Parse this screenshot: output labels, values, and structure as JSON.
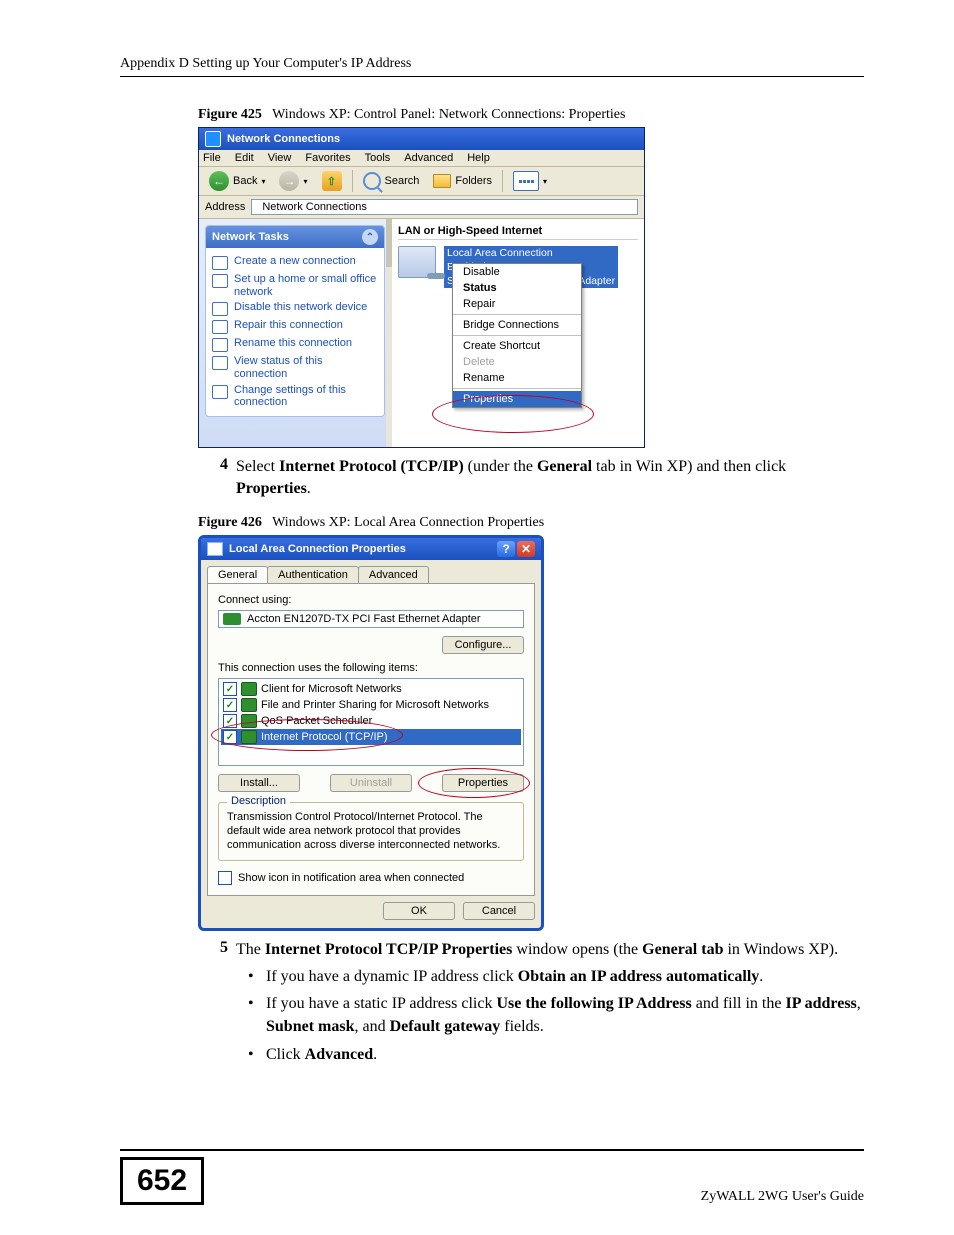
{
  "header": "Appendix D Setting up Your Computer's IP Address",
  "figure425": {
    "label": "Figure 425",
    "caption": "Windows XP: Control Panel: Network Connections: Properties",
    "title": "Network Connections",
    "menu": [
      "File",
      "Edit",
      "View",
      "Favorites",
      "Tools",
      "Advanced",
      "Help"
    ],
    "toolbar": {
      "back": "Back",
      "search": "Search",
      "folders": "Folders"
    },
    "address_label": "Address",
    "address_value": "Network Connections",
    "tasks_header": "Network Tasks",
    "tasks": [
      "Create a new connection",
      "Set up a home or small office network",
      "Disable this network device",
      "Repair this connection",
      "Rename this connection",
      "View status of this connection",
      "Change settings of this connection"
    ],
    "group_header": "LAN or High-Speed Internet",
    "connection": {
      "name": "Local Area Connection",
      "status": "Enabled",
      "device": "Standard PCI Fast Ethernet Adapter"
    },
    "context_menu": {
      "disable": "Disable",
      "status": "Status",
      "repair": "Repair",
      "bridge": "Bridge Connections",
      "shortcut": "Create Shortcut",
      "delete": "Delete",
      "rename": "Rename",
      "properties": "Properties"
    }
  },
  "step4": {
    "num": "4",
    "pre": "Select ",
    "b1": "Internet Protocol (TCP/IP)",
    "mid": " (under the ",
    "b2": "General",
    "post": " tab in Win XP) and then click ",
    "b3": "Properties",
    "end": "."
  },
  "figure426": {
    "label": "Figure 426",
    "caption": "Windows XP: Local Area Connection Properties",
    "title": "Local Area Connection Properties",
    "tabs": [
      "General",
      "Authentication",
      "Advanced"
    ],
    "connect_using": "Connect using:",
    "adapter": "Accton EN1207D-TX PCI Fast Ethernet Adapter",
    "configure": "Configure...",
    "items_label": "This connection uses the following items:",
    "items": [
      "Client for Microsoft Networks",
      "File and Printer Sharing for Microsoft Networks",
      "QoS Packet Scheduler",
      "Internet Protocol (TCP/IP)"
    ],
    "install": "Install...",
    "uninstall": "Uninstall",
    "properties_btn": "Properties",
    "desc_header": "Description",
    "description": "Transmission Control Protocol/Internet Protocol. The default wide area network protocol that provides communication across diverse interconnected networks.",
    "show_icon": "Show icon in notification area when connected",
    "ok": "OK",
    "cancel": "Cancel"
  },
  "step5": {
    "num": "5",
    "pre": "The ",
    "b1": "Internet Protocol TCP/IP Properties",
    "mid": " window opens (the ",
    "b2": "General tab",
    "post": " in Windows XP)."
  },
  "bullets": {
    "a_pre": "If you have a dynamic IP address click ",
    "a_b": "Obtain an IP address automatically",
    "a_post": ".",
    "b_pre": "If you have a static IP address click ",
    "b_b1": "Use the following IP Address",
    "b_mid": " and fill in the ",
    "b_b2": "IP address",
    "b_sep1": ", ",
    "b_b3": "Subnet mask",
    "b_sep2": ", and ",
    "b_b4": "Default gateway",
    "b_post": " fields.",
    "c_pre": "Click ",
    "c_b": "Advanced",
    "c_post": "."
  },
  "footer": {
    "page": "652",
    "guide": "ZyWALL 2WG User's Guide"
  }
}
